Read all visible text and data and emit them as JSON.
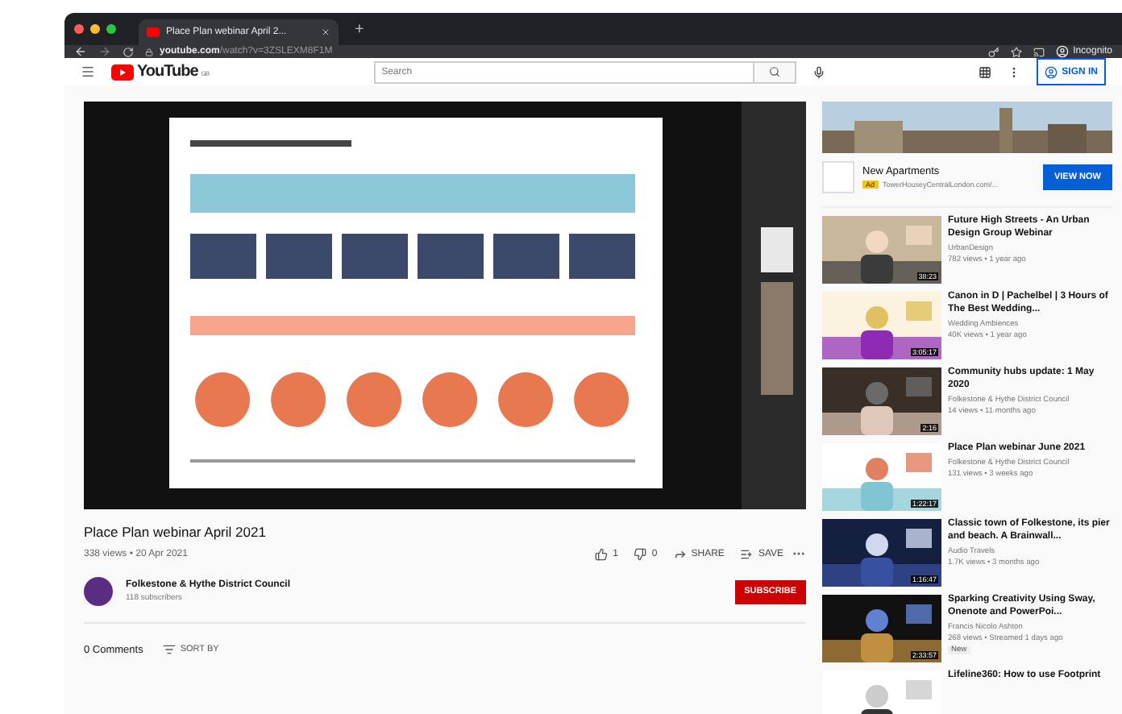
{
  "browser": {
    "tab_title": "Place Plan webinar April 2...",
    "new_tab": "+",
    "url_host": "youtube.com",
    "url_path": "/watch?v=3ZSLEXM8F1M",
    "profile": "Incognito"
  },
  "header": {
    "logo": "YouTube",
    "region": "GB",
    "search_placeholder": "Search",
    "sign_in": "SIGN IN"
  },
  "video": {
    "kind": "picture",
    "title": "Place Plan webinar April 2021",
    "meta": "338 views • 20 Apr 2021",
    "likes": "1",
    "dislikes": "0",
    "share": "SHARE",
    "save": "SAVE"
  },
  "channel": {
    "name": "Folkestone & Hythe District Council",
    "subscribers": "118 subscribers",
    "subscribe": "SUBSCRIBE"
  },
  "comments": {
    "count": "0 Comments",
    "sort": "SORT BY"
  },
  "ad": {
    "title": "New Apartments",
    "badge": "Ad",
    "url": "TowerHouseyCentralLondon.com/...",
    "button": "VIEW NOW"
  },
  "recommendations": [
    {
      "title": "Future High Streets - An Urban Design Group Webinar",
      "channel": "UrbanDesign",
      "meta": "782 views • 1 year ago",
      "duration": "38:23"
    },
    {
      "title": "Canon in D | Pachelbel | 3 Hours of The Best Wedding...",
      "channel": "Wedding Ambiences",
      "meta": "40K views • 1 year ago",
      "duration": "3:05:17"
    },
    {
      "title": "Community hubs update: 1 May 2020",
      "channel": "Folkestone & Hythe District Council",
      "meta": "14 views • 11 months ago",
      "duration": "2:16"
    },
    {
      "title": "Place Plan webinar June 2021",
      "channel": "Folkestone & Hythe District Council",
      "meta": "131 views • 3 weeks ago",
      "duration": "1:22:17"
    },
    {
      "title": "Classic town of Folkestone, its pier and beach. A Brainwall...",
      "channel": "Audio Travels",
      "meta": "1.7K views • 3 months ago",
      "duration": "1:16:47"
    },
    {
      "title": "Sparking Creativity Using Sway, Onenote and PowerPoi...",
      "channel": "Francis Nicolo Ashton",
      "meta": "268 views • Streamed 1 days ago",
      "duration": "2:33:57",
      "badge": "New"
    },
    {
      "title": "Lifeline360: How to use Footprint"
    }
  ]
}
